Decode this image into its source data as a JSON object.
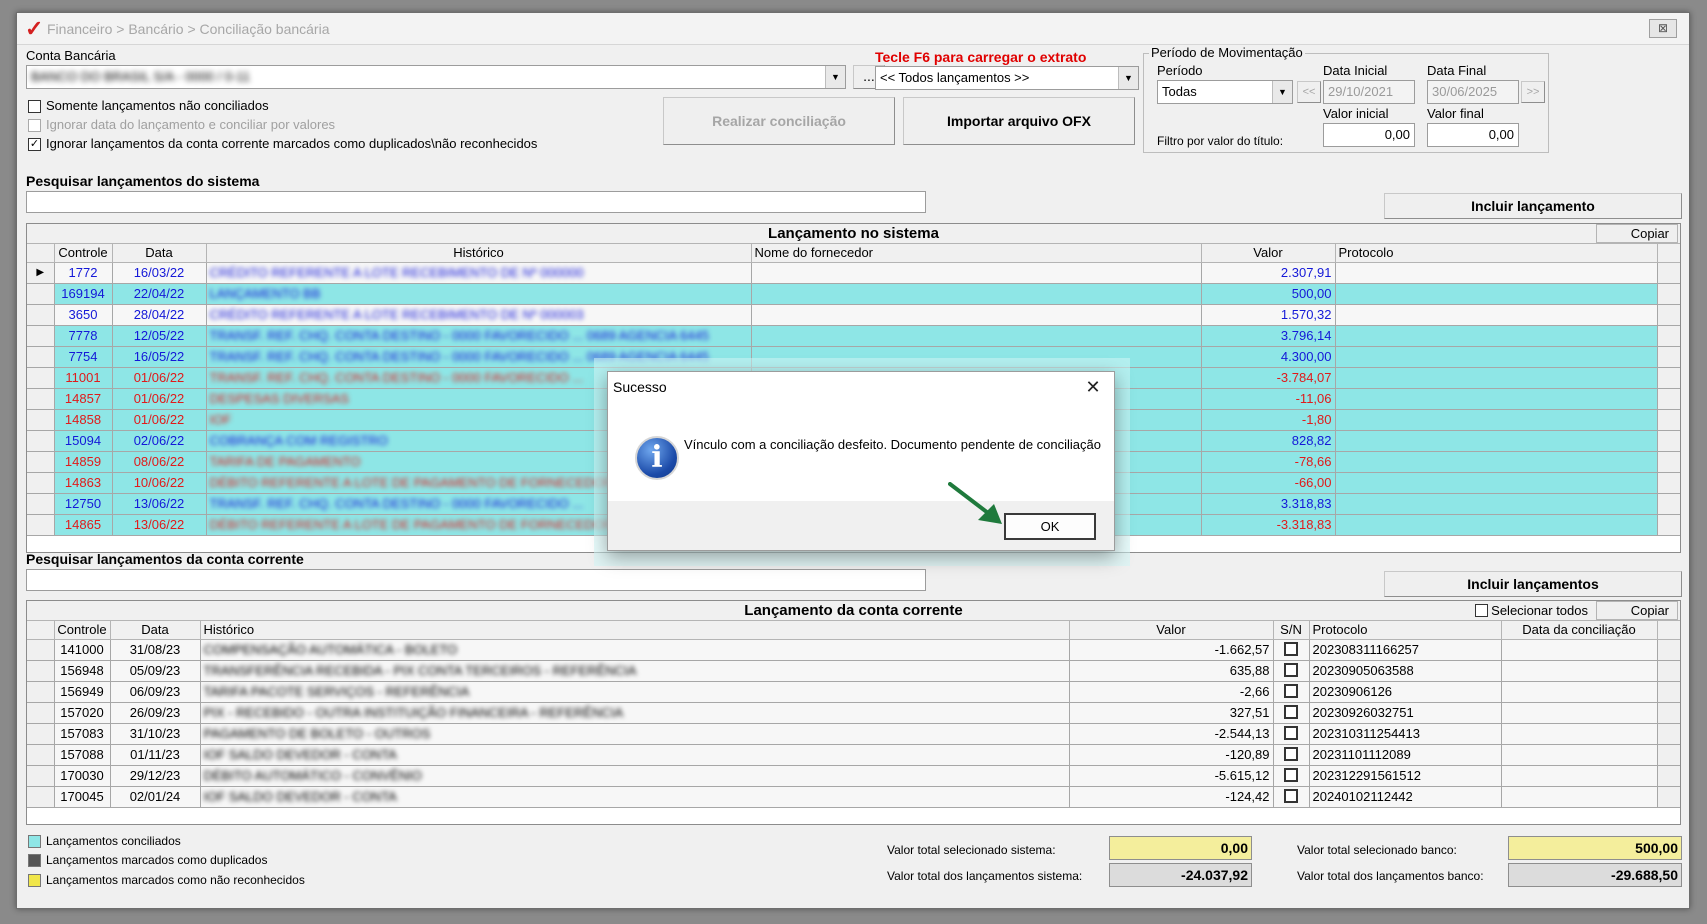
{
  "window": {
    "breadcrumb": "Financeiro > Bancário > Conciliação bancária",
    "close_glyph": "⊠"
  },
  "top": {
    "conta_label": "Conta Bancária",
    "conta_value": "BANCO DO BRASIL S/A - 0000 / 0-11",
    "browse_label": "...",
    "f6_label": "Tecle F6 para carregar o extrato",
    "lancamentos_combo": "<< Todos lançamentos >>",
    "chk_nao_conciliados": "Somente lançamentos não conciliados",
    "chk_ignorar_data": "Ignorar data do lançamento e conciliar por valores",
    "chk_ignorar_duplicados": "Ignorar lançamentos da conta corrente marcados como duplicados\\não reconhecidos",
    "realizar_btn": "Realizar conciliação",
    "importar_btn": "Importar arquivo OFX",
    "periodo_group": "Período de Movimentação",
    "periodo_label": "Período",
    "periodo_value": "Todas",
    "data_inicial_label": "Data Inicial",
    "data_inicial": "29/10/2021",
    "data_final_label": "Data Final",
    "data_final": "30/06/2025",
    "prev_btn": "<<",
    "next_btn": ">>",
    "valor_inicial_label": "Valor inicial",
    "valor_final_label": "Valor final",
    "filtro_label": "Filtro por valor do título:",
    "valor_inicial": "0,00",
    "valor_final": "0,00",
    "pesquisar_sistema_label": "Pesquisar lançamentos do sistema",
    "incluir_lancamento_btn": "Incluir lançamento"
  },
  "sistema": {
    "caption": "Lançamento no sistema",
    "copiar": "Copiar",
    "headers": [
      "Controle",
      "Data",
      "Histórico",
      "Nome do fornecedor",
      "Valor",
      "Protocolo"
    ],
    "rows": [
      {
        "controle": "1772",
        "data": "16/03/22",
        "historico": "CRÉDITO REFERENTE A LOTE RECEBIMENTO DE Nº 000000",
        "valor": "2.307,91",
        "color": "blue",
        "style": "w",
        "current": true
      },
      {
        "controle": "169194",
        "data": "22/04/22",
        "historico": "LANÇAMENTO BB",
        "valor": "500,00",
        "color": "blue",
        "style": "ok"
      },
      {
        "controle": "3650",
        "data": "28/04/22",
        "historico": "CRÉDITO REFERENTE A LOTE RECEBIMENTO DE Nº 000003",
        "valor": "1.570,32",
        "color": "blue",
        "style": "w"
      },
      {
        "controle": "7778",
        "data": "12/05/22",
        "historico": "TRANSF. REF. CHQ. CONTA DESTINO - 0000 FAVORECIDO ... 0689 AGENCIA   6445",
        "valor": "3.796,14",
        "color": "blue",
        "style": "ok"
      },
      {
        "controle": "7754",
        "data": "16/05/22",
        "historico": "TRANSF. REF. CHQ. CONTA DESTINO - 0000 FAVORECIDO ... 0689 AGENCIA   6445",
        "valor": "4.300,00",
        "color": "blue",
        "style": "ok"
      },
      {
        "controle": "11001",
        "data": "01/06/22",
        "historico": "TRANSF. REF. CHQ. CONTA DESTINO - 0000 FAVORECIDO ...",
        "valor": "-3.784,07",
        "color": "red",
        "style": "ok"
      },
      {
        "controle": "14857",
        "data": "01/06/22",
        "historico": "DESPESAS DIVERSAS",
        "valor": "-11,06",
        "color": "red",
        "style": "ok"
      },
      {
        "controle": "14858",
        "data": "01/06/22",
        "historico": "IOF",
        "valor": "-1,80",
        "color": "red",
        "style": "ok"
      },
      {
        "controle": "15094",
        "data": "02/06/22",
        "historico": "COBRANÇA COM REGISTRO",
        "valor": "828,82",
        "color": "blue",
        "style": "ok"
      },
      {
        "controle": "14859",
        "data": "08/06/22",
        "historico": "TARIFA DE PAGAMENTO",
        "valor": "-78,66",
        "color": "red",
        "style": "ok"
      },
      {
        "controle": "14863",
        "data": "10/06/22",
        "historico": "DÉBITO REFERENTE A LOTE DE PAGAMENTO DE FORNECEDOR",
        "valor": "-66,00",
        "color": "red",
        "style": "ok"
      },
      {
        "controle": "12750",
        "data": "13/06/22",
        "historico": "TRANSF. REF. CHQ. CONTA DESTINO - 0000 FAVORECIDO ...",
        "valor": "3.318,83",
        "color": "blue",
        "style": "ok"
      },
      {
        "controle": "14865",
        "data": "13/06/22",
        "historico": "DÉBITO REFERENTE A LOTE DE PAGAMENTO DE FORNECEDOR",
        "valor": "-3.318,83",
        "color": "red",
        "style": "ok"
      }
    ]
  },
  "conta": {
    "pesquisar_label": "Pesquisar lançamentos da conta corrente",
    "incluir_btn": "Incluir lançamentos",
    "caption": "Lançamento da conta corrente",
    "selecionar_todos": "Selecionar todos",
    "copiar": "Copiar",
    "headers": [
      "Controle",
      "Data",
      "Histórico",
      "Valor",
      "S/N",
      "Protocolo",
      "Data da conciliação"
    ],
    "rows": [
      {
        "controle": "141000",
        "data": "31/08/23",
        "historico": "COMPENSAÇÃO AUTOMÁTICA - BOLETO",
        "valor": "-1.662,57",
        "protocolo": "202308311166257"
      },
      {
        "controle": "156948",
        "data": "05/09/23",
        "historico": "TRANSFERÊNCIA RECEBIDA - PIX CONTA TERCEIROS - REFERÊNCIA",
        "valor": "635,88",
        "protocolo": "20230905063588"
      },
      {
        "controle": "156949",
        "data": "06/09/23",
        "historico": "TARIFA PACOTE SERVIÇOS - REFERÊNCIA",
        "valor": "-2,66",
        "protocolo": "20230906126"
      },
      {
        "controle": "157020",
        "data": "26/09/23",
        "historico": "PIX - RECEBIDO - OUTRA INSTITUIÇÃO FINANCEIRA - REFERÊNCIA",
        "valor": "327,51",
        "protocolo": "20230926032751"
      },
      {
        "controle": "157083",
        "data": "31/10/23",
        "historico": "PAGAMENTO DE BOLETO - OUTROS",
        "valor": "-2.544,13",
        "protocolo": "202310311254413"
      },
      {
        "controle": "157088",
        "data": "01/11/23",
        "historico": "IOF SALDO DEVEDOR - CONTA",
        "valor": "-120,89",
        "protocolo": "20231101112089"
      },
      {
        "controle": "170030",
        "data": "29/12/23",
        "historico": "DÉBITO AUTOMÁTICO - CONVÊNIO",
        "valor": "-5.615,12",
        "protocolo": "202312291561512"
      },
      {
        "controle": "170045",
        "data": "02/01/24",
        "historico": "IOF SALDO DEVEDOR - CONTA",
        "valor": "-124,42",
        "protocolo": "20240102112442"
      }
    ]
  },
  "legend": {
    "conciliados": "Lançamentos conciliados",
    "duplicados": "Lançamentos marcados como duplicados",
    "nao_reconhecidos": "Lançamentos marcados como não reconhecidos",
    "color_conciliados": "#8ee6e6",
    "color_duplicados": "#555555",
    "color_nao_reconhecidos": "#f0e64a"
  },
  "totals": {
    "sel_sistema_label": "Valor total selecionado sistema:",
    "sel_sistema": "0,00",
    "total_sistema_label": "Valor total dos lançamentos sistema:",
    "total_sistema": "-24.037,92",
    "sel_banco_label": "Valor total selecionado banco:",
    "sel_banco": "500,00",
    "total_banco_label": "Valor total dos lançamentos banco:",
    "total_banco": "-29.688,50"
  },
  "dialog": {
    "title": "Sucesso",
    "close": "✕",
    "icon": "information-icon",
    "message": "Vínculo com a conciliação desfeito. Documento pendente de conciliação",
    "ok": "OK"
  }
}
